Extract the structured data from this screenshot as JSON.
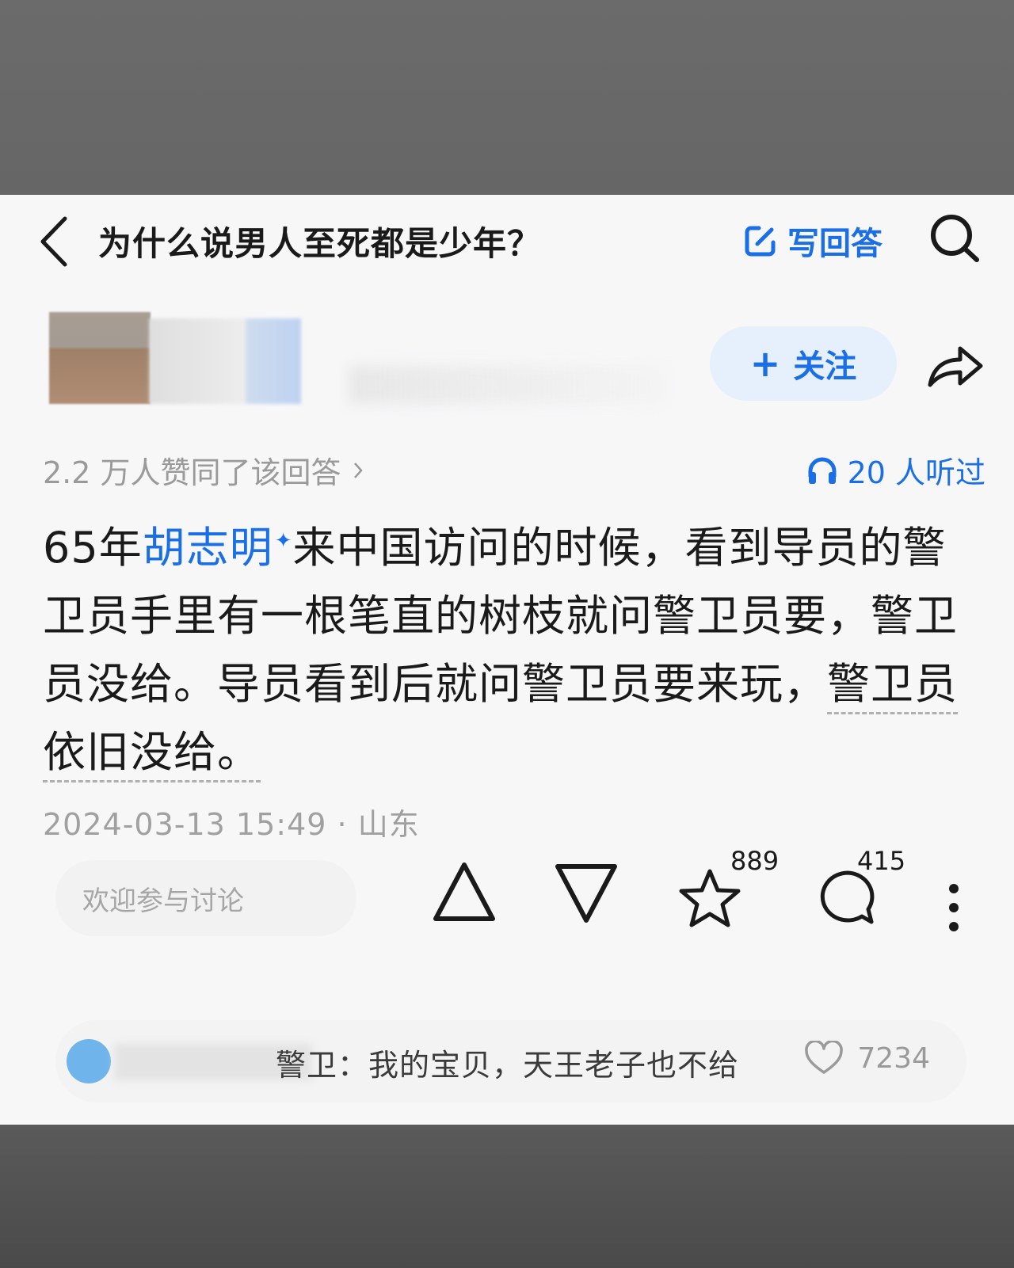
{
  "header": {
    "title": "为什么说男人至死都是少年？",
    "write_answer_label": "写回答"
  },
  "author": {
    "follow_label": "关注"
  },
  "stats": {
    "agree_text": "2.2 万人赞同了该回答",
    "listen_text": "20 人听过"
  },
  "answer": {
    "prefix": "65年",
    "link_text": "胡志明",
    "line_rest": "来中国访问的时候，看到导员的警卫员手里有一根笔直的树枝就问警卫员要，警卫员没给。导员看到后就问警卫员要来玩，",
    "dotted_text": "警卫员依旧没给。"
  },
  "meta": {
    "datetime": "2024-03-13 15:49",
    "location": "山东"
  },
  "actions": {
    "comment_placeholder": "欢迎参与讨论",
    "favorite_count": "889",
    "comment_count": "415"
  },
  "hot_comment": {
    "text": "警卫：我的宝贝，天王老子也不给",
    "like_count": "7234"
  },
  "colors": {
    "accent": "#1a6fe6",
    "text": "#1a1a1a",
    "muted": "#9a9a9a"
  }
}
